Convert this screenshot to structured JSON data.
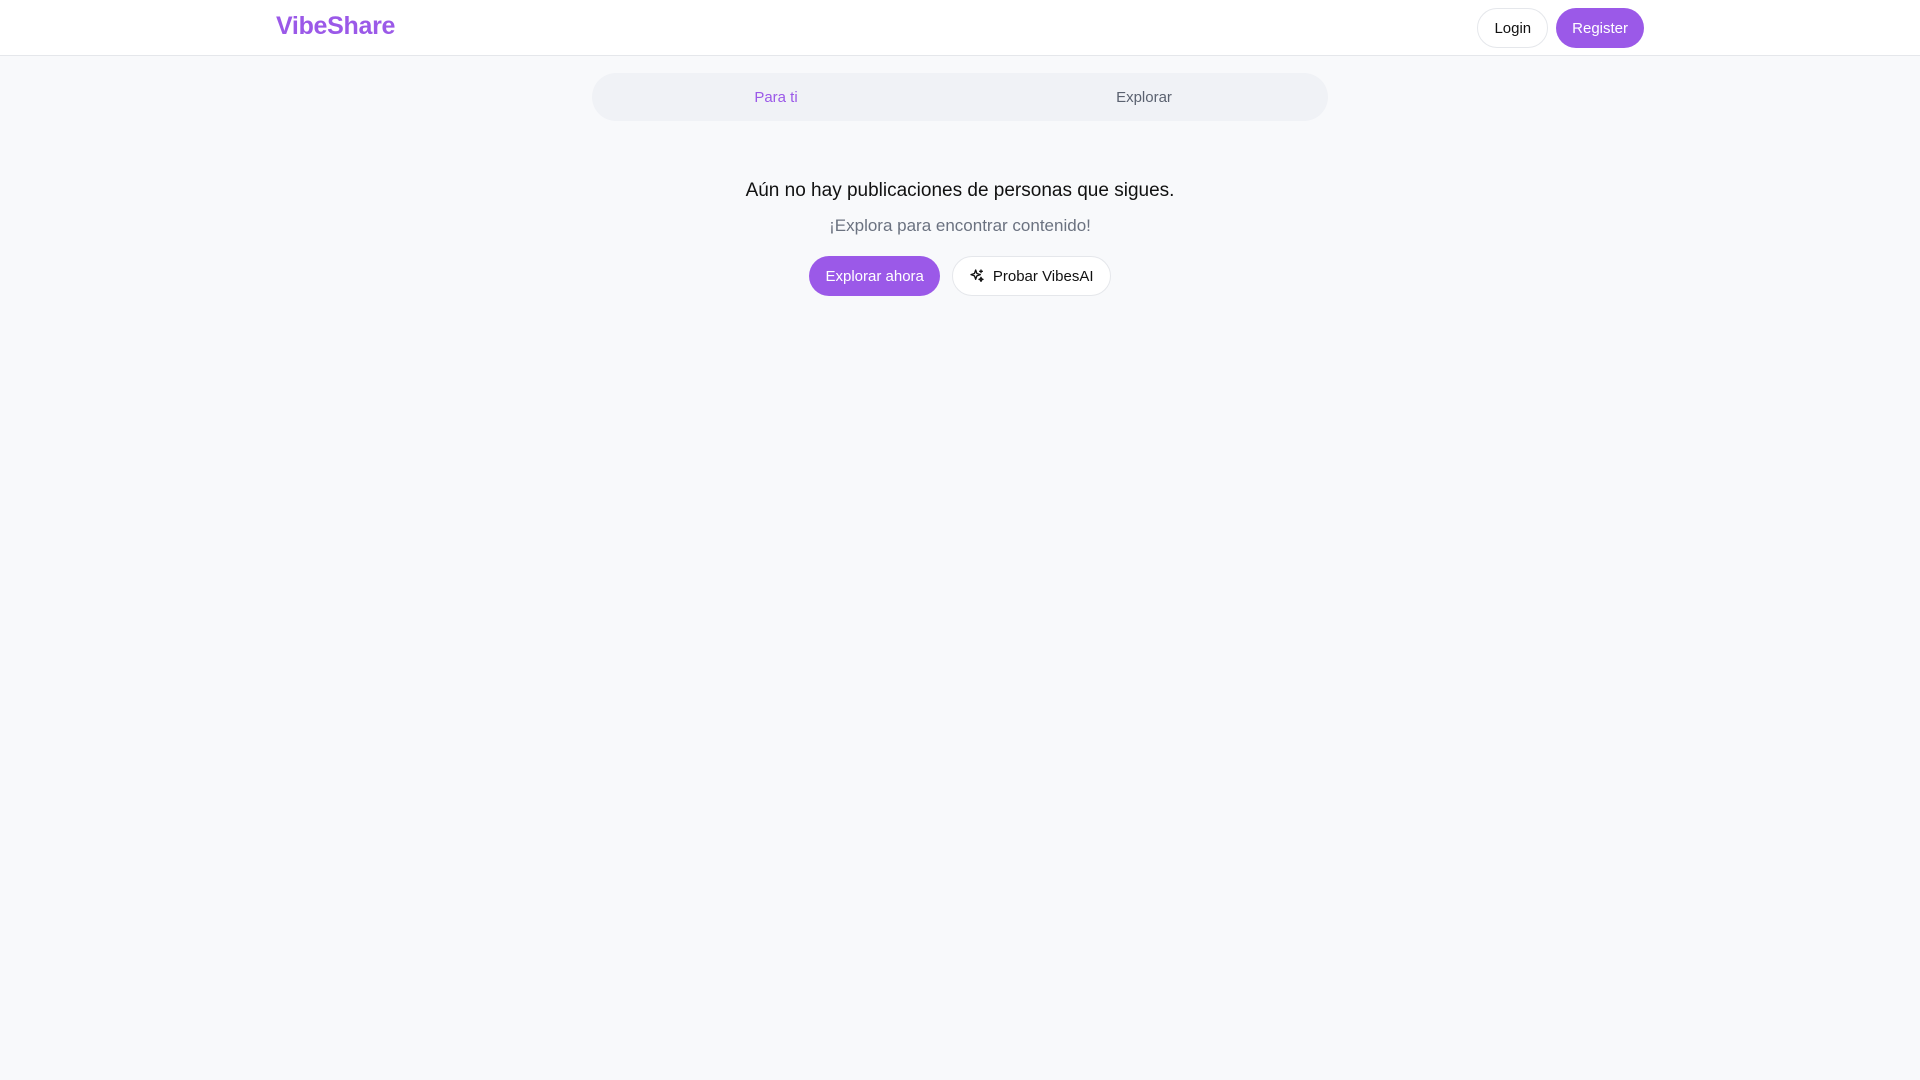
{
  "header": {
    "logo": "VibeShare",
    "login_label": "Login",
    "register_label": "Register"
  },
  "tabs": [
    {
      "label": "Para ti",
      "active": true
    },
    {
      "label": "Explorar",
      "active": false
    }
  ],
  "empty_state": {
    "title": "Aún no hay publicaciones de personas que sigues.",
    "subtitle": "¡Explora para encontrar contenido!",
    "explore_label": "Explorar ahora",
    "vibesai_label": "Probar VibesAI",
    "vibesai_icon": "sparkle-icon"
  },
  "colors": {
    "accent": "#9b59e8",
    "background": "#f8f9fb",
    "tab_bg": "#f0f2f6"
  }
}
